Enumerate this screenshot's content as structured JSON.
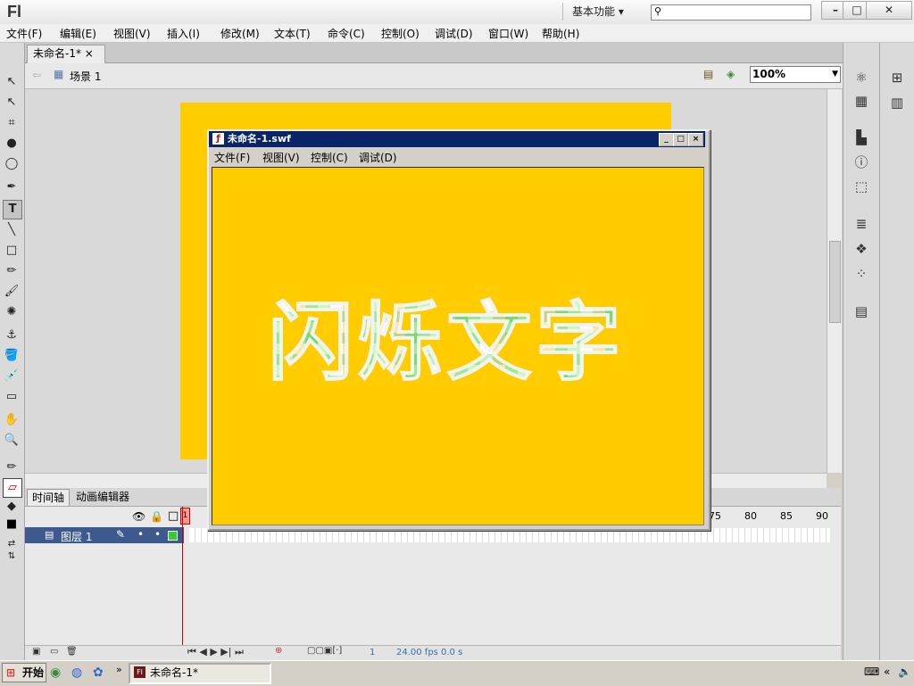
{
  "app": {
    "logo": "Fl",
    "workspace": "基本功能",
    "workspace_arrow": "▾",
    "window_buttons": [
      "–",
      "□",
      "✕"
    ]
  },
  "menubar": {
    "items": [
      "文件(F)",
      "编辑(E)",
      "视图(V)",
      "插入(I)",
      "修改(M)",
      "文本(T)",
      "命令(C)",
      "控制(O)",
      "调试(D)",
      "窗口(W)",
      "帮助(H)"
    ]
  },
  "document_tab": {
    "label": "未命名-1*",
    "close": "×"
  },
  "editbar": {
    "scene_label": "场景 1",
    "zoom": "100%"
  },
  "tools": {
    "icons": [
      "↖",
      "↖",
      "⌗",
      "●",
      "◯",
      "✒",
      "T",
      "╲",
      "□",
      "✏",
      "🖌",
      "✺",
      "⚓",
      "🪣",
      "💉",
      "▭",
      "✋",
      "🔍",
      "✏",
      "▱",
      "◆",
      "■",
      "⇄",
      "⇅"
    ]
  },
  "timeline": {
    "tabs": [
      "时间轴",
      "动画编辑器"
    ],
    "layer_name": "图层 1",
    "frame_numbers": [
      "75",
      "80",
      "85",
      "90"
    ],
    "header_playhead": "1",
    "footer": {
      "frame": "1",
      "fps": "24.00 fps",
      "time": "0.0 s"
    }
  },
  "swf_window": {
    "title": "未命名-1.swf",
    "menu": [
      "文件(F)",
      "视图(V)",
      "控制(C)",
      "调试(D)"
    ],
    "flash_text": "闪烁文字"
  },
  "taskbar": {
    "start": "开始",
    "task": "未命名-1*"
  },
  "colors": {
    "stage": "#ffcc00",
    "title_bar": "#0a246a",
    "layer_selected": "#3d5a8f"
  }
}
